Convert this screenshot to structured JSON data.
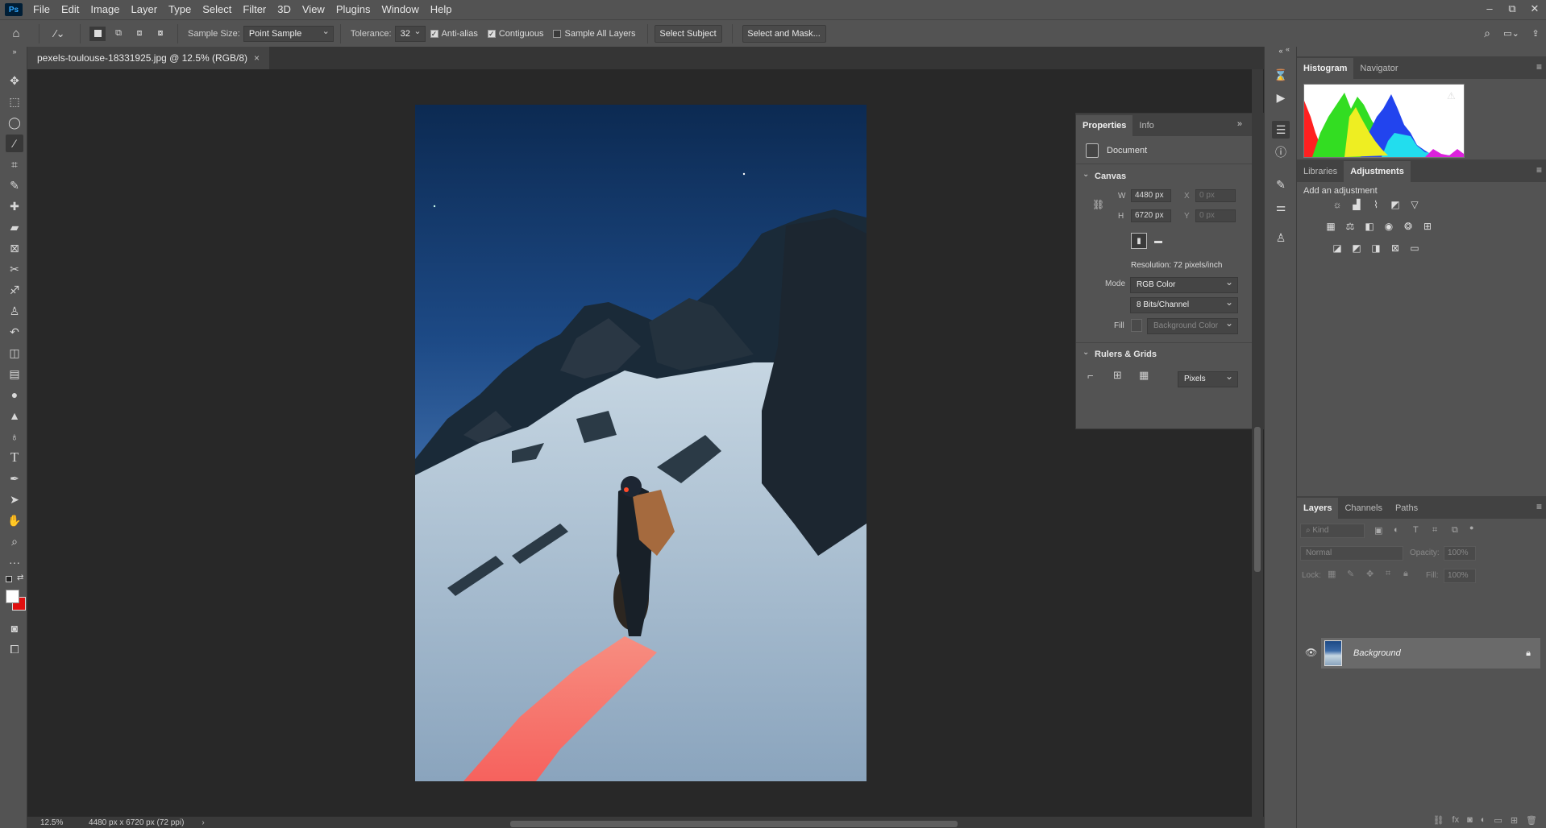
{
  "menubar": {
    "logo": "Ps",
    "items": [
      "File",
      "Edit",
      "Image",
      "Layer",
      "Type",
      "Select",
      "Filter",
      "3D",
      "View",
      "Plugins",
      "Window",
      "Help"
    ],
    "window_controls": [
      "–",
      "⧉",
      "✕"
    ]
  },
  "options": {
    "sample_size_label": "Sample Size:",
    "sample_size_value": "Point Sample",
    "tolerance_label": "Tolerance:",
    "tolerance_value": "32",
    "anti_alias_label": "Anti-alias",
    "contiguous_label": "Contiguous",
    "sample_all_layers_label": "Sample All Layers",
    "select_subject_label": "Select Subject",
    "select_and_mask_label": "Select and Mask..."
  },
  "document": {
    "tab_title": "pexels-toulouse-18331925.jpg @ 12.5% (RGB/8)",
    "close_glyph": "×"
  },
  "status": {
    "zoom": "12.5%",
    "doc_info": "4480 px x 6720 px (72 ppi)"
  },
  "properties": {
    "tabs": [
      "Properties",
      "Info"
    ],
    "document_label": "Document",
    "canvas_section": "Canvas",
    "w_label": "W",
    "w_value": "4480 px",
    "h_label": "H",
    "h_value": "6720 px",
    "x_label": "X",
    "x_placeholder": "0 px",
    "y_label": "Y",
    "y_placeholder": "0 px",
    "resolution": "Resolution: 72 pixels/inch",
    "mode_label": "Mode",
    "mode_value": "RGB Color",
    "bits_value": "8 Bits/Channel",
    "fill_label": "Fill",
    "fill_value": "Background Color",
    "rulers_section": "Rulers & Grids",
    "units_value": "Pixels"
  },
  "right_panels": {
    "top_tabs": [
      "Histogram",
      "Navigator"
    ],
    "mid_tabs": [
      "Libraries",
      "Adjustments"
    ],
    "add_adjustment": "Add an adjustment",
    "layer_tabs": [
      "Layers",
      "Channels",
      "Paths"
    ],
    "kind_placeholder": "Kind",
    "blend_mode": "Normal",
    "opacity_label": "Opacity:",
    "opacity_value": "100%",
    "lock_label": "Lock:",
    "fill_label": "Fill:",
    "fill_value": "100%",
    "layer_name": "Background"
  },
  "colors": {
    "chrome": "#535353",
    "canvas_bg": "#282828",
    "panel_tab_bg": "#424242",
    "ps_blue": "#31a8ff"
  }
}
